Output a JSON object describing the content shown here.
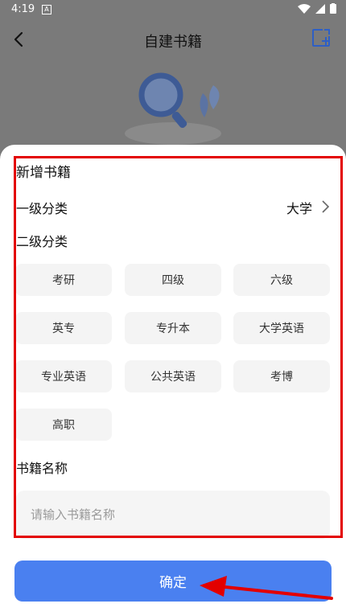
{
  "status_bar": {
    "time": "4:19",
    "notif_glyph": "A"
  },
  "header": {
    "title": "自建书籍",
    "icons": [
      "back-arrow-icon",
      "new-book-icon"
    ]
  },
  "form": {
    "heading": "新增书籍",
    "level1": {
      "label": "一级分类",
      "value": "大学"
    },
    "level2": {
      "label": "二级分类",
      "options": [
        "考研",
        "四级",
        "六级",
        "英专",
        "专升本",
        "大学英语",
        "专业英语",
        "公共英语",
        "考博",
        "高职"
      ]
    },
    "book_name": {
      "label": "书籍名称",
      "placeholder": "请输入书籍名称",
      "value": ""
    }
  },
  "confirm_label": "确定",
  "colors": {
    "accent": "#4a80f0",
    "annotation": "#e30000"
  }
}
